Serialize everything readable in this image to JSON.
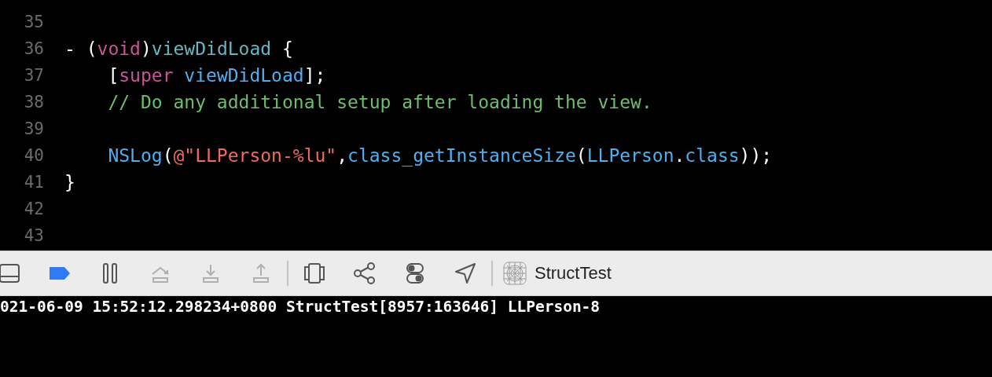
{
  "editor": {
    "lines": [
      {
        "number": "35"
      },
      {
        "number": "36",
        "tokens": [
          {
            "kind": "plain",
            "text": "- ("
          },
          {
            "kind": "keyword",
            "text": "void"
          },
          {
            "kind": "plain",
            "text": ")"
          },
          {
            "kind": "declaration",
            "text": "viewDidLoad"
          },
          {
            "kind": "plain",
            "text": " {"
          }
        ]
      },
      {
        "number": "37",
        "tokens": [
          {
            "kind": "plain",
            "text": "    ["
          },
          {
            "kind": "keyword",
            "text": "super"
          },
          {
            "kind": "call",
            "text": " viewDidLoad"
          },
          {
            "kind": "plain",
            "text": "];"
          }
        ]
      },
      {
        "number": "38",
        "tokens": [
          {
            "kind": "comment",
            "text": "    // Do any additional setup after loading the view."
          }
        ]
      },
      {
        "number": "39"
      },
      {
        "number": "40",
        "tokens": [
          {
            "kind": "call",
            "text": "    NSLog"
          },
          {
            "kind": "plain",
            "text": "("
          },
          {
            "kind": "string",
            "text": "@\"LLPerson-%lu\""
          },
          {
            "kind": "plain",
            "text": ","
          },
          {
            "kind": "call",
            "text": "class_getInstanceSize"
          },
          {
            "kind": "plain",
            "text": "("
          },
          {
            "kind": "call",
            "text": "LLPerson"
          },
          {
            "kind": "plain",
            "text": "."
          },
          {
            "kind": "call",
            "text": "class"
          },
          {
            "kind": "plain",
            "text": "));"
          }
        ]
      },
      {
        "number": "41",
        "tokens": [
          {
            "kind": "plain",
            "text": "}"
          }
        ]
      },
      {
        "number": "42"
      },
      {
        "number": "43"
      }
    ]
  },
  "toolbar": {
    "items": [
      {
        "kind": "panel-toggle",
        "on": false,
        "disabled": false
      },
      {
        "kind": "breakpoints",
        "on": true,
        "disabled": false
      },
      {
        "kind": "pause",
        "on": false,
        "disabled": false
      },
      {
        "kind": "step-over",
        "on": false,
        "disabled": true
      },
      {
        "kind": "step-in",
        "on": false,
        "disabled": true
      },
      {
        "kind": "step-out",
        "on": false,
        "disabled": true
      },
      {
        "kind": "divider"
      },
      {
        "kind": "view-hierarchy",
        "on": false,
        "disabled": false
      },
      {
        "kind": "memory-graph",
        "on": false,
        "disabled": false
      },
      {
        "kind": "environment",
        "on": false,
        "disabled": false
      },
      {
        "kind": "location",
        "on": false,
        "disabled": false
      },
      {
        "kind": "divider"
      },
      {
        "kind": "target",
        "label": "StructTest"
      }
    ]
  },
  "console": {
    "lines": [
      "021-06-09 15:52:12.298234+0800 StructTest[8957:163646] LLPerson-8"
    ]
  }
}
